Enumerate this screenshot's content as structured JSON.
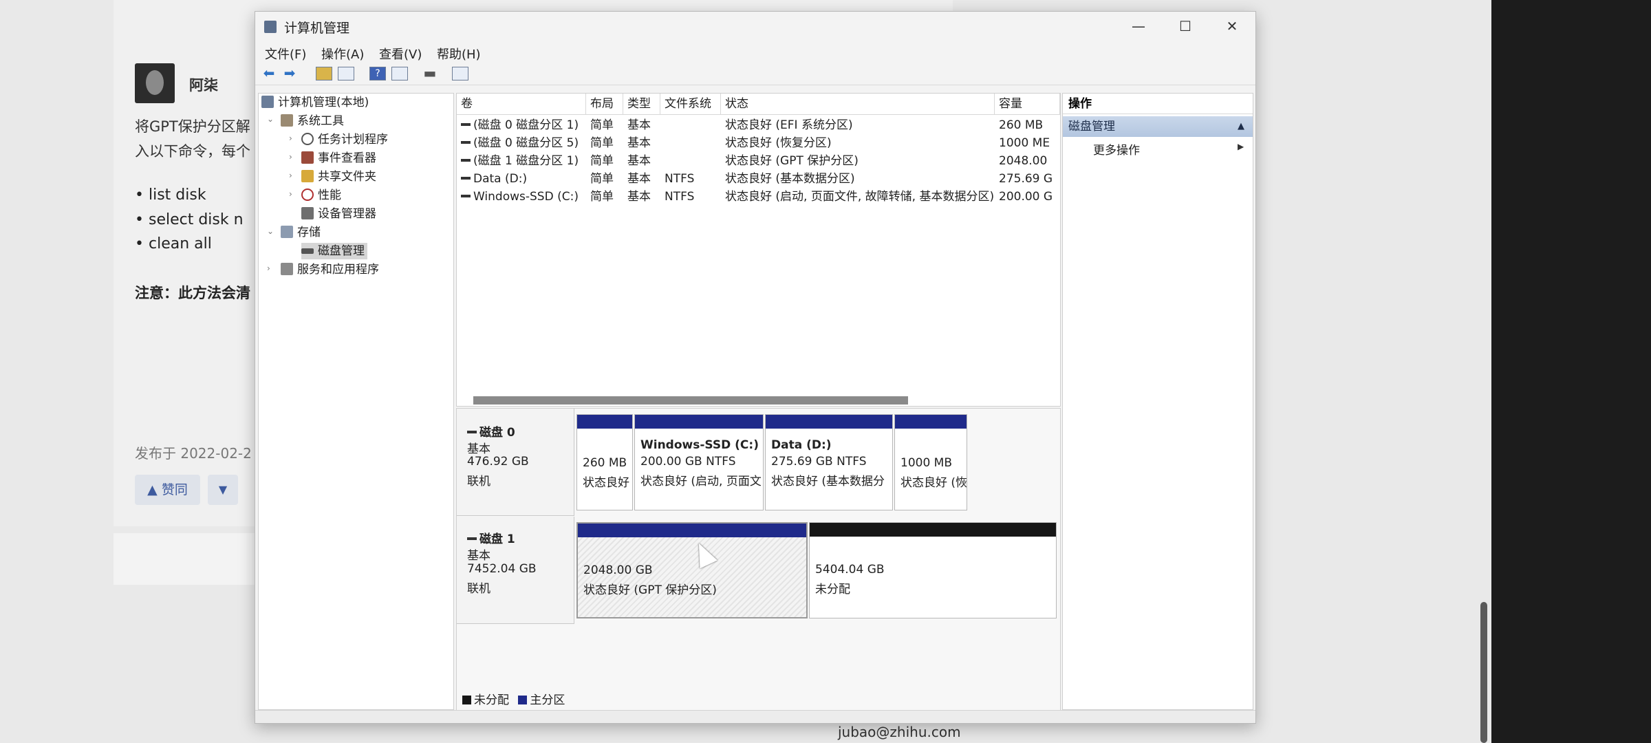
{
  "background": {
    "author": "阿柒",
    "line1": "将GPT保护分区解",
    "line2": "入以下命令，每个",
    "bullets": [
      "list disk",
      "select disk n",
      "clean all"
    ],
    "note": "注意：此方法会清",
    "date": "发布于 2022-02-2",
    "vote_label": "▲ 赞同",
    "vote_down": "▼",
    "email": "jubao@zhihu.com"
  },
  "window": {
    "title": "计算机管理",
    "controls": {
      "minimize": "—",
      "maximize": "☐",
      "close": "✕"
    }
  },
  "menu": [
    "文件(F)",
    "操作(A)",
    "查看(V)",
    "帮助(H)"
  ],
  "tree": {
    "root": "计算机管理(本地)",
    "system_tools": "系统工具",
    "task_scheduler": "任务计划程序",
    "event_viewer": "事件查看器",
    "shared_folders": "共享文件夹",
    "performance": "性能",
    "device_manager": "设备管理器",
    "storage": "存储",
    "disk_management": "磁盘管理",
    "services": "服务和应用程序"
  },
  "volumes": {
    "headers": [
      "卷",
      "布局",
      "类型",
      "文件系统",
      "状态",
      "容量"
    ],
    "rows": [
      [
        "(磁盘 0 磁盘分区 1)",
        "简单",
        "基本",
        "",
        "状态良好 (EFI 系统分区)",
        "260 MB"
      ],
      [
        "(磁盘 0 磁盘分区 5)",
        "简单",
        "基本",
        "",
        "状态良好 (恢复分区)",
        "1000 ME"
      ],
      [
        "(磁盘 1 磁盘分区 1)",
        "简单",
        "基本",
        "",
        "状态良好 (GPT 保护分区)",
        "2048.00"
      ],
      [
        "Data (D:)",
        "简单",
        "基本",
        "NTFS",
        "状态良好 (基本数据分区)",
        "275.69 G"
      ],
      [
        "Windows-SSD (C:)",
        "简单",
        "基本",
        "NTFS",
        "状态良好 (启动, 页面文件, 故障转储, 基本数据分区)",
        "200.00 G"
      ]
    ]
  },
  "disks": {
    "disk0": {
      "name": "磁盘 0",
      "type": "基本",
      "size": "476.92 GB",
      "status": "联机",
      "parts": [
        {
          "title": "",
          "size": "260 MB",
          "status": "状态良好"
        },
        {
          "title": "Windows-SSD  (C:)",
          "size": "200.00 GB NTFS",
          "status": "状态良好 (启动, 页面文"
        },
        {
          "title": "Data  (D:)",
          "size": "275.69 GB NTFS",
          "status": "状态良好 (基本数据分"
        },
        {
          "title": "",
          "size": "1000 MB",
          "status": "状态良好 (恢"
        }
      ]
    },
    "disk1": {
      "name": "磁盘 1",
      "type": "基本",
      "size": "7452.04 GB",
      "status": "联机",
      "parts": [
        {
          "size": "2048.00 GB",
          "status": "状态良好 (GPT 保护分区)"
        },
        {
          "size": "5404.04 GB",
          "status": "未分配"
        }
      ]
    }
  },
  "legend": {
    "unallocated": "未分配",
    "primary": "主分区"
  },
  "actions": {
    "header": "操作",
    "section": "磁盘管理",
    "more": "更多操作"
  },
  "colors": {
    "primary_partition": "#1f2a8a",
    "unallocated": "#161616",
    "selected_section": "#b3c6e0"
  }
}
